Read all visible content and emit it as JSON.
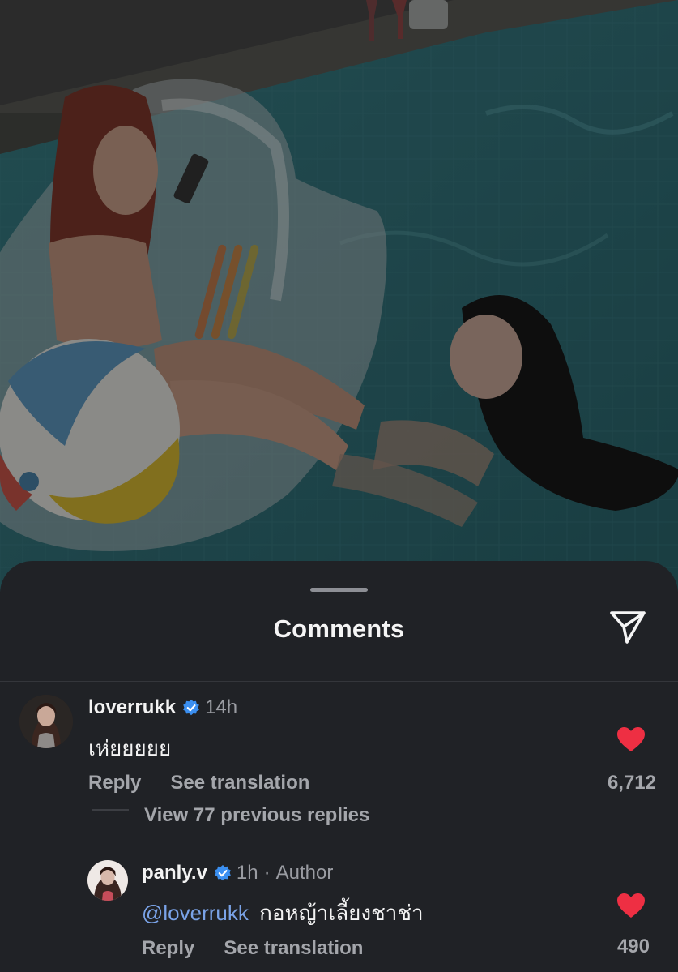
{
  "sheet": {
    "title": "Comments",
    "share_icon": "paper-plane-icon"
  },
  "comments": [
    {
      "username": "loverrukk",
      "verified": true,
      "time": "14h",
      "text": "เห่ยยยยย",
      "reply_label": "Reply",
      "translate_label": "See translation",
      "likes": "6,712",
      "liked": true
    }
  ],
  "replies_toggle": "View 77 previous replies",
  "replies": [
    {
      "username": "panly.v",
      "verified": true,
      "time": "1h",
      "separator": "·",
      "badge": "Author",
      "mention": "@loverrukk",
      "text": "กอหญ้าเลี้ยงชาช่า",
      "reply_label": "Reply",
      "translate_label": "See translation",
      "likes": "490",
      "liked": true
    }
  ],
  "colors": {
    "sheet_bg": "#202226",
    "heart": "#ee2f43",
    "verified": "#3b8ff0",
    "mention": "#7aa3e8",
    "secondary_text": "#a4a6ab"
  }
}
